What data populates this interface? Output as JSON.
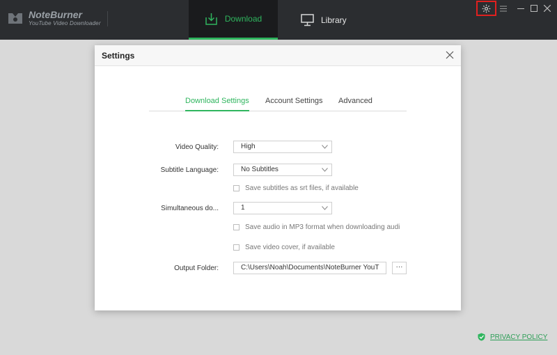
{
  "app": {
    "brand_name": "NoteBurner",
    "brand_subtitle": "YouTube Video Downloader"
  },
  "nav": {
    "download": "Download",
    "library": "Library"
  },
  "colors": {
    "accent": "#2fb55e",
    "titlebar": "#2b2d30",
    "highlight_box": "#e0201f"
  },
  "dialog": {
    "title": "Settings",
    "tabs": {
      "download": "Download Settings",
      "account": "Account Settings",
      "advanced": "Advanced"
    },
    "video_quality": {
      "label": "Video Quality:",
      "value": "High"
    },
    "subtitle_language": {
      "label": "Subtitle Language:",
      "value": "No Subtitles"
    },
    "save_subtitles": {
      "label": "Save subtitles as srt files, if available",
      "checked": false
    },
    "simultaneous": {
      "label": "Simultaneous do...",
      "value": "1"
    },
    "save_mp3": {
      "label": "Save audio in MP3 format when downloading audi",
      "checked": false
    },
    "save_cover": {
      "label": "Save video cover, if available",
      "checked": false
    },
    "output_folder": {
      "label": "Output Folder:",
      "value": "C:\\Users\\Noah\\Documents\\NoteBurner YouT",
      "browse": "···"
    }
  },
  "footer": {
    "privacy": "PRIVACY POLICY"
  },
  "icons": [
    "logo-icon",
    "download-icon",
    "monitor-icon",
    "gear-icon",
    "menu-icon",
    "minimize-icon",
    "maximize-icon",
    "close-icon",
    "shield-icon",
    "chevron-down-icon"
  ]
}
